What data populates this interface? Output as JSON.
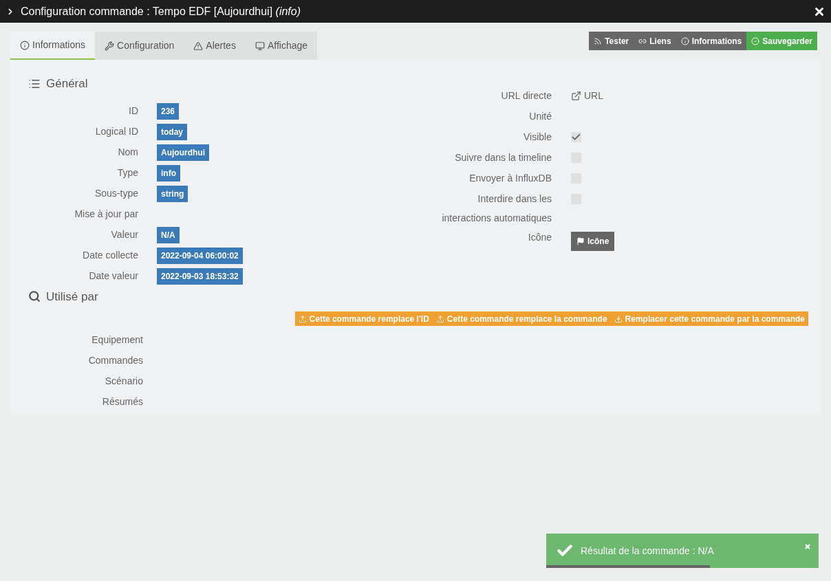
{
  "window": {
    "title": "Configuration commande : Tempo EDF [Aujourdhui] *(info)*"
  },
  "tabs": [
    {
      "label": "Informations",
      "selected": true
    },
    {
      "label": "Configuration",
      "selected": false
    },
    {
      "label": "Alertes",
      "selected": false
    },
    {
      "label": "Affichage",
      "selected": false
    }
  ],
  "toolbar": [
    {
      "label": "Tester",
      "kind": "dark"
    },
    {
      "label": "Liens",
      "kind": "dark"
    },
    {
      "label": "Informations",
      "kind": "dark"
    },
    {
      "label": "Sauvegarder",
      "kind": "success"
    }
  ],
  "general": {
    "title": "Général",
    "fields": [
      {
        "label": "ID",
        "value": "236"
      },
      {
        "label": "Logical ID",
        "value": "today"
      },
      {
        "label": "Nom",
        "value": "Aujourdhui"
      },
      {
        "label": "Type",
        "value": "info"
      },
      {
        "label": "Sous-type",
        "value": "string"
      },
      {
        "label": "Mise à jour par"
      },
      {
        "label": "Valeur",
        "value": "N/A"
      },
      {
        "label": "Date collecte",
        "value": "2022-09-04 06:00:02"
      },
      {
        "label": "Date valeur",
        "value": "2022-09-03 18:53:32"
      }
    ]
  },
  "settings": [
    {
      "label": "URL directe",
      "kind": "link",
      "value": "URL"
    },
    {
      "label": "Unité",
      "kind": "empty"
    },
    {
      "label": "Visible",
      "kind": "checkbox",
      "checked": true
    },
    {
      "label": "Suivre dans la timeline",
      "kind": "checkbox",
      "checked": false
    },
    {
      "label": "Envoyer à InfluxDB",
      "kind": "checkbox",
      "checked": false
    },
    {
      "label": "Interdire dans les interactions automatiques",
      "kind": "checkbox",
      "checked": false
    },
    {
      "label": "Icône",
      "kind": "button",
      "value": "Icône"
    }
  ],
  "used_by": {
    "title": "Utilisé par",
    "actions": [
      {
        "label": "Cette commande remplace l'ID",
        "kind": "upload"
      },
      {
        "label": "Cette commande remplace la commande",
        "kind": "upload"
      },
      {
        "label": "Remplacer cette commande par la commande",
        "kind": "download"
      }
    ],
    "rows": [
      "Equipement",
      "Commandes",
      "Scénario",
      "Résumés"
    ]
  },
  "toast": {
    "message": "Résultat de la commande : N/A",
    "level": 0.6
  }
}
